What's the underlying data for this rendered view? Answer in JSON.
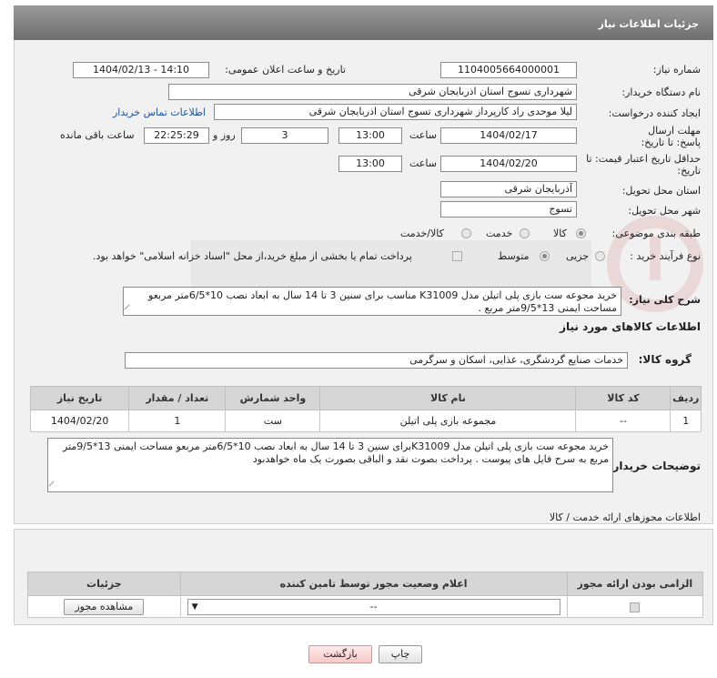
{
  "header": {
    "title": "جزئیات اطلاعات نیاز"
  },
  "form": {
    "need_number": {
      "label": "شماره نیاز:",
      "value": "1104005664000001"
    },
    "announce": {
      "label": "تاریخ و ساعت اعلان عمومی:",
      "value": "1404/02/13 - 14:10"
    },
    "buyer_org": {
      "label": "نام دستگاه خریدار:",
      "value": "شهرداری تسوج استان اذربایجان شرقی"
    },
    "creator": {
      "label": "ایجاد کننده درخواست:",
      "value": "لیلا موحدی راد کارپرداز شهرداری تسوج استان اذربایجان شرقی",
      "link": "اطلاعات تماس خریدار"
    },
    "deadline": {
      "label": "مهلت ارسال پاسخ: تا تاریخ:",
      "date": "1404/02/17",
      "time_label": "ساعت",
      "time": "13:00",
      "days": "3",
      "days_label": "روز و",
      "remaining": "22:25:29",
      "remaining_label": "ساعت باقی مانده"
    },
    "price_validity": {
      "label": "حداقل تاریخ اعتبار قیمت: تا تاریخ:",
      "date": "1404/02/20",
      "time_label": "ساعت",
      "time": "13:00"
    },
    "province": {
      "label": "استان محل تحویل:",
      "value": "آذربایجان شرقی"
    },
    "city": {
      "label": "شهر محل تحویل:",
      "value": "تسوج"
    },
    "category": {
      "label": "طبقه بندی موضوعی:",
      "options": [
        "کالا",
        "خدمت",
        "کالا/خدمت"
      ],
      "selected": "کالا"
    },
    "process": {
      "label": "نوع فرآیند خرید :",
      "options": [
        "جزیی",
        "متوسط"
      ],
      "selected": "متوسط",
      "note": "پرداخت تمام یا بخشی از مبلغ خرید،از محل \"اسناد خزانه اسلامی\" خواهد بود."
    }
  },
  "summary": {
    "label": "شرح کلی نیاز:",
    "text": "خرید مجوعه ست بازی پلی اتیلن مدل  K31009 مناسب برای سنین 3 تا 14 سال به ابعاد نصب 10*6/5متر مربعو مساحت ایمنی 13*9/5متر مربع ."
  },
  "goods": {
    "section_title": "اطلاعات کالاهای مورد نیاز",
    "group_label": "گروه کالا:",
    "group_value": "خدمات صنایع گردشگری، غذایی، اسکان و سرگرمی",
    "columns": [
      "ردیف",
      "کد کالا",
      "نام کالا",
      "واحد شمارش",
      "تعداد / مقدار",
      "تاریخ نیاز"
    ],
    "rows": [
      {
        "index": "1",
        "code": "--",
        "name": "مجموعه بازی پلی اتیلن",
        "unit": "ست",
        "qty": "1",
        "date": "1404/02/20"
      }
    ]
  },
  "buyer_notes": {
    "label": "توضیحات خریدار:",
    "text": "خرید مجوعه ست بازی پلی اتیلن مدل  K31009برای سنین 3 تا 14 سال به ابعاد نصب 10*6/5متر مربعو مساحت ایمنی 13*9/5متر مربع به سرح  فایل های پیوست . پرداخت بصوت نقد و الباقی بصورت یک ماه  خواهدبود"
  },
  "permits": {
    "section_title": "اطلاعات مجوزهای ارائه خدمت / کالا",
    "columns": [
      "الزامی بودن ارائه مجوز",
      "اعلام وضعیت مجوز توسط تامین کننده",
      "جزئیات"
    ],
    "select_value": "--",
    "view_button": "مشاهده مجوز"
  },
  "actions": {
    "print": "چاپ",
    "back": "بازگشت"
  },
  "colors": {
    "header_bg": "#7f7f7f",
    "panel_bg": "#f1f1f1",
    "link": "#1a55a8",
    "back_button": "#f6c9c9"
  }
}
